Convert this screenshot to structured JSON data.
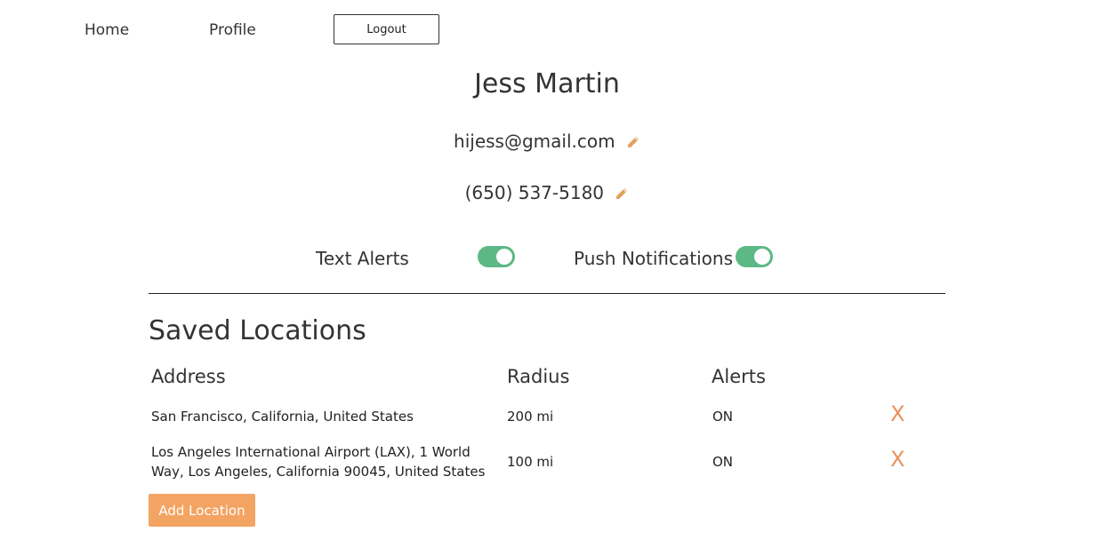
{
  "nav": {
    "home_label": "Home",
    "profile_label": "Profile",
    "logout_label": "Logout"
  },
  "profile": {
    "name": "Jess Martin",
    "email": "hijess@gmail.com",
    "phone": "(650) 537-5180"
  },
  "settings": {
    "text_alerts": {
      "label": "Text Alerts",
      "on": true
    },
    "push_notifications": {
      "label": "Push Notifications",
      "on": true
    }
  },
  "locations": {
    "title": "Saved Locations",
    "headers": {
      "address": "Address",
      "radius": "Radius",
      "alerts": "Alerts"
    },
    "rows": [
      {
        "address": "San Francisco, California, United States",
        "radius": "200 mi",
        "alerts": "ON",
        "remove": "X"
      },
      {
        "address": "Los Angeles International Airport (LAX), 1 World Way, Los Angeles, California 90045, United States",
        "radius": "100 mi",
        "alerts": "ON",
        "remove": "X"
      }
    ],
    "add_label": "Add Location"
  },
  "colors": {
    "toggle_on": "#5cb884",
    "accent": "#f3a462",
    "remove": "#e8925a",
    "edit_icon": "#e3a15a"
  },
  "icons": {
    "edit": "pencil-icon",
    "remove": "close-icon"
  }
}
